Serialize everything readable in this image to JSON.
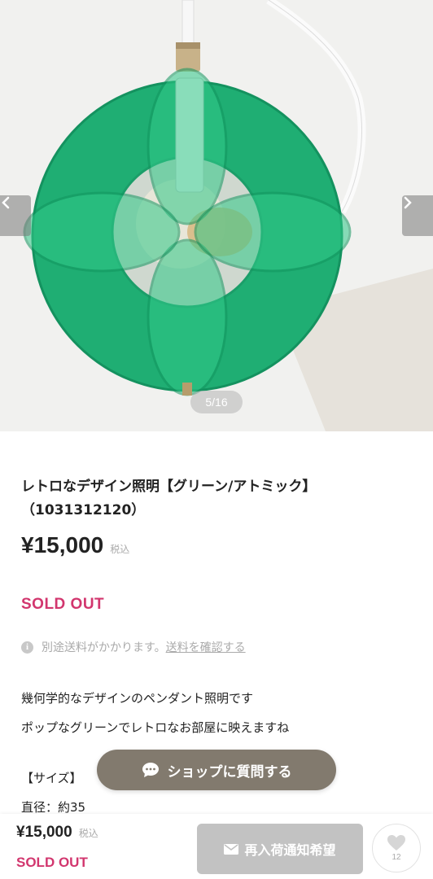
{
  "carousel": {
    "counter": "5/16",
    "prev_icon": "chevron-left-icon",
    "next_icon": "chevron-right-icon",
    "image_subject": "green retro pendant lamp"
  },
  "product": {
    "title_line1": "レトロなデザイン照明【グリーン/アトミック】",
    "title_line2": "（1031312120）",
    "price": "¥15,000",
    "tax_label": "税込",
    "status": "SOLD OUT",
    "shipping_text": "別途送料がかかります。",
    "shipping_link": "送料を確認する",
    "description": [
      "幾何学的なデザインのペンダント照明です",
      "ポップなグリーンでレトロなお部屋に映えますね",
      "【サイズ】",
      "直径：約35"
    ]
  },
  "ask_button": {
    "label": "ショップに質問する",
    "icon": "chat-bubble-icon"
  },
  "bottom_bar": {
    "price": "¥15,000",
    "tax_label": "税込",
    "status": "SOLD OUT",
    "notify_label": "再入荷通知希望",
    "notify_icon": "mail-icon",
    "favorite_icon": "heart-icon",
    "favorite_count": "12"
  },
  "colors": {
    "accent_pink": "#d2366e",
    "ask_button_bg": "#827a6e",
    "notify_button_bg": "#c2c2c2",
    "lamp_green": "#1fae73"
  }
}
